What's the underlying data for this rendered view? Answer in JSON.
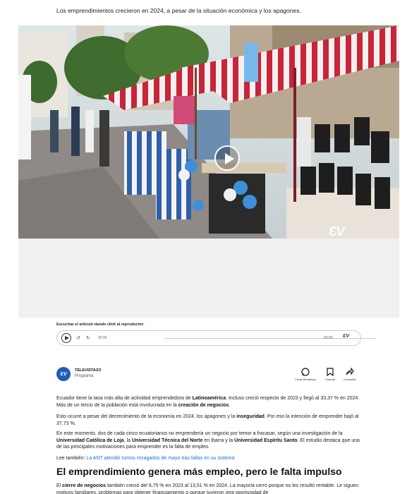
{
  "article": {
    "subtitle": "Los emprendimientos crecieron en 2024, a pesar de la situación económica y los apagones."
  },
  "video": {
    "watermark": "ƐV"
  },
  "audio_player": {
    "listen_label": "Escuchar el artículo dando click al reproductor:",
    "back_label": "↺",
    "forward_label": "↻",
    "time_current": "00:00",
    "time_total": "00:00",
    "brand": "ƐV"
  },
  "author": {
    "logo_text": "ƐV",
    "name": "TELEVISTAZO",
    "role": "Programa"
  },
  "actions": {
    "whatsapp": "Canal WhatsApp",
    "save": "Guardar",
    "share": "Compartir"
  },
  "body": {
    "p1_a": "Ecuador tiene la tasa más alta de actividad emprendedora de ",
    "p1_b": "Latinoamérica",
    "p1_c": ". Incluso creció respecto de 2023 y llegó al 33,37 % en 2024. Más de un tercio de la población está involucrada en la ",
    "p1_d": "creación de negocios",
    "p1_e": ".",
    "p2_a": "Esto ocurre a pesar del decrecimiento de la economía en 2024, los apagones y la ",
    "p2_b": "inseguridad",
    "p2_c": ". Por eso la intención de emprender bajó al 37,73 %.",
    "p3_a": "En este momento, dos de cada cinco ecuatorianos no emprendería un negocio por temor a fracasar, según una investigación de la ",
    "p3_b": "Universidad Católica de Loja",
    "p3_c": ", la ",
    "p3_d": "Universidad Técnica del Norte",
    "p3_e": " en Ibarra y la ",
    "p3_f": "Universidad Espíritu Santo",
    "p3_g": ". El estudio destaca que una de las principales motivaciones para emprender es la falta de empleo.",
    "see_also_prefix": "Lee también: ",
    "see_also_link": "La ANT atendió turnos rezagados de mayo tras fallas en su sistema",
    "heading": "El emprendimiento genera más empleo, pero le falta impulso",
    "p4_a": "El ",
    "p4_b": "cierre de negocios",
    "p4_c": " también creció del 9,75 % en 2023 al 13,51 % en 2024. La mayoría cerró porque no les resultó rentable. Le siguen: motivos familiares, problemas para obtener financiamiento o porque tuvieron otra oportunidad de"
  }
}
